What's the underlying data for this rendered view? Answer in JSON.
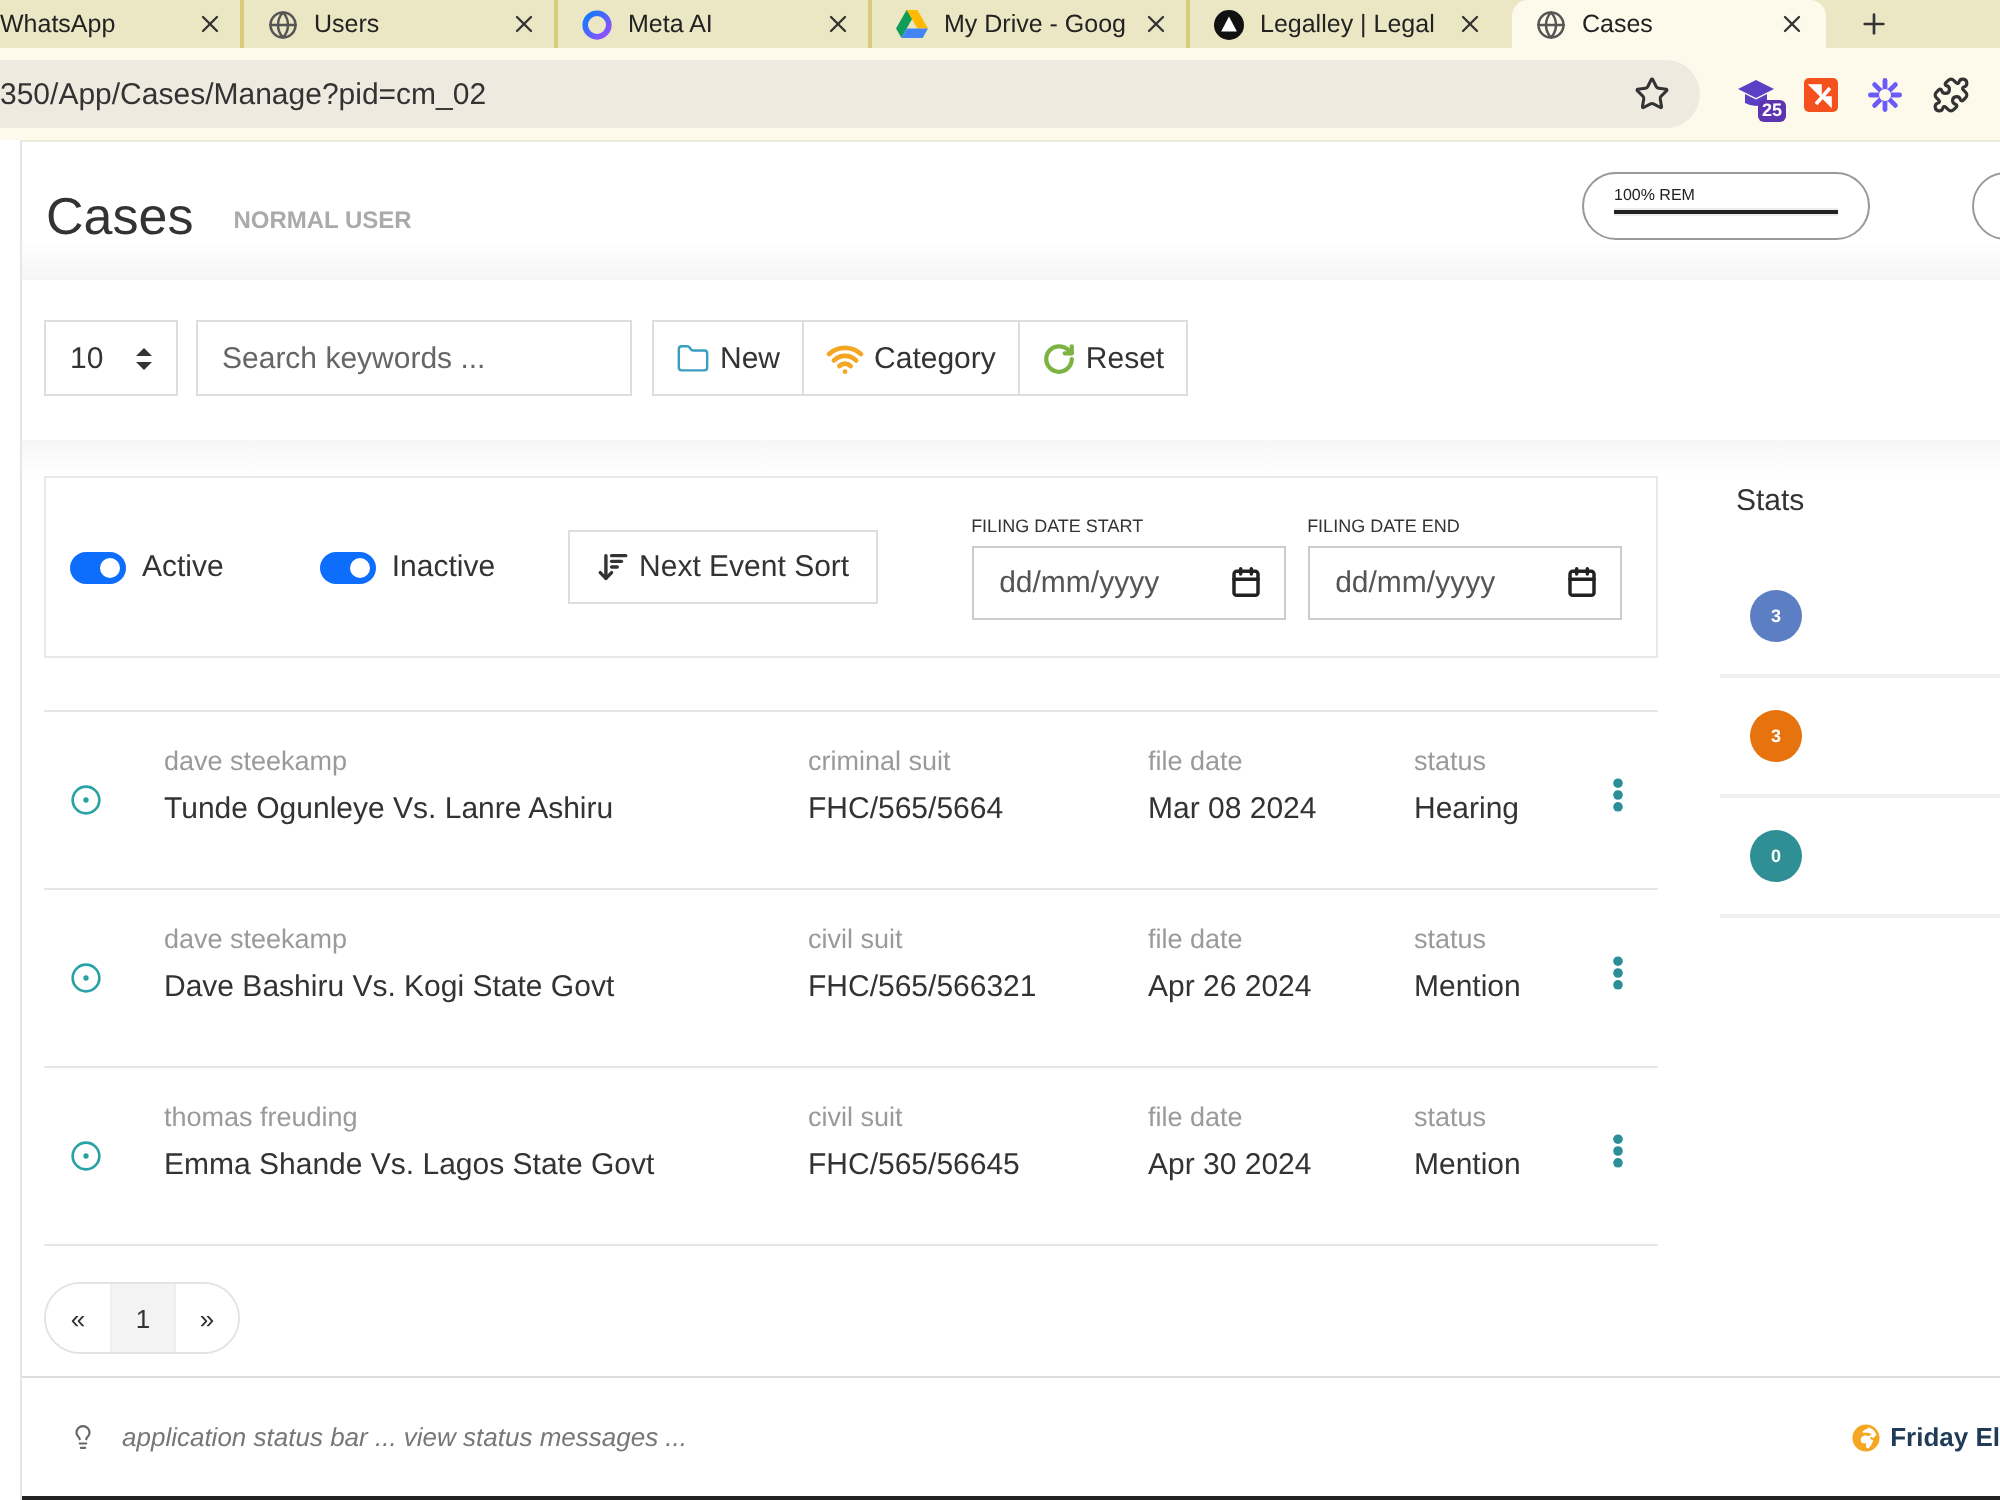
{
  "browser": {
    "tabs": [
      {
        "title": "WhatsApp",
        "kind": "plain",
        "selected": false
      },
      {
        "title": "Users",
        "kind": "globe",
        "selected": false
      },
      {
        "title": "Meta AI",
        "kind": "ring",
        "selected": false
      },
      {
        "title": "My Drive - Goog",
        "kind": "drive",
        "selected": false
      },
      {
        "title": "Legalley | Legal",
        "kind": "logo",
        "selected": false
      },
      {
        "title": "Cases",
        "kind": "globe",
        "selected": true
      }
    ],
    "url": "350/App/Cases/Manage?pid=cm_02",
    "extension_badge": "25"
  },
  "header": {
    "title": "Cases",
    "role": "NORMAL USER",
    "quota": {
      "label": "100% REM",
      "level": 1
    }
  },
  "toolbar": {
    "page_size": "10",
    "search": {
      "placeholder": "Search keywords ..."
    },
    "buttons": [
      {
        "label": "New",
        "kind": "folder"
      },
      {
        "label": "Category",
        "kind": "wifi"
      },
      {
        "label": "Reset",
        "kind": "refresh"
      }
    ]
  },
  "filters": {
    "toggles": [
      {
        "label": "Active",
        "on": true
      },
      {
        "label": "Inactive",
        "on": true
      }
    ],
    "sort_button": "Next Event Sort",
    "date_fields": [
      {
        "label": "FILING DATE START",
        "placeholder": "dd/mm/yyyy"
      },
      {
        "label": "FILING DATE END",
        "placeholder": "dd/mm/yyyy"
      }
    ]
  },
  "cases": [
    {
      "lawyer": "dave steekamp",
      "title": "Tunde Ogunleye Vs. Lanre Ashiru",
      "type": "criminal suit",
      "number": "FHC/565/5664",
      "date_label": "file date",
      "date": "Mar 08 2024",
      "status_label": "status",
      "status": "Hearing"
    },
    {
      "lawyer": "dave steekamp",
      "title": "Dave Bashiru Vs. Kogi State Govt",
      "type": "civil suit",
      "number": "FHC/565/566321",
      "date_label": "file date",
      "date": "Apr 26 2024",
      "status_label": "status",
      "status": "Mention"
    },
    {
      "lawyer": "thomas freuding",
      "title": "Emma Shande Vs. Lagos State Govt",
      "type": "civil suit",
      "number": "FHC/565/56645",
      "date_label": "file date",
      "date": "Apr 30 2024",
      "status_label": "status",
      "status": "Mention"
    }
  ],
  "pagination": {
    "prev": "«",
    "pages": [
      {
        "label": "1",
        "selected": true
      }
    ],
    "next": "»"
  },
  "stats": {
    "title": "Stats",
    "items": [
      {
        "count": "3",
        "color": "#5b7fc2"
      },
      {
        "count": "3",
        "color": "#e6730d"
      },
      {
        "count": "0",
        "color": "#2f8f94"
      }
    ]
  },
  "status_bar": {
    "message": "application status bar ... view status messages ...",
    "greeting": "Friday El"
  }
}
